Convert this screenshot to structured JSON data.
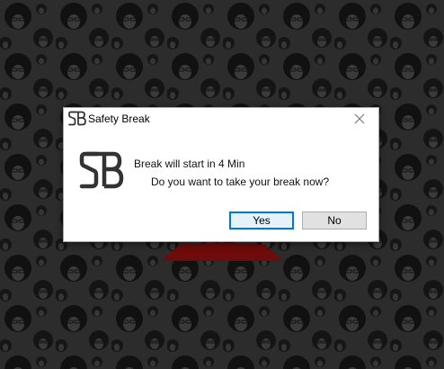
{
  "window": {
    "title": "Safety Break",
    "close_icon": "close-icon",
    "app_icon": "safety-break-logo-icon"
  },
  "message": {
    "line1": "Break will start in 4 Min",
    "line2": "Do you want to take your break now?"
  },
  "buttons": {
    "yes_label": "Yes",
    "no_label": "No"
  },
  "colors": {
    "background": "#2b2b2b",
    "pattern": "#111111",
    "dialog": "#ffffff",
    "default_button_border": "#0078d7",
    "default_button_fill": "#e5f1fb",
    "button_fill": "#e1e1e1",
    "accent_red": "#7a0c0c"
  }
}
